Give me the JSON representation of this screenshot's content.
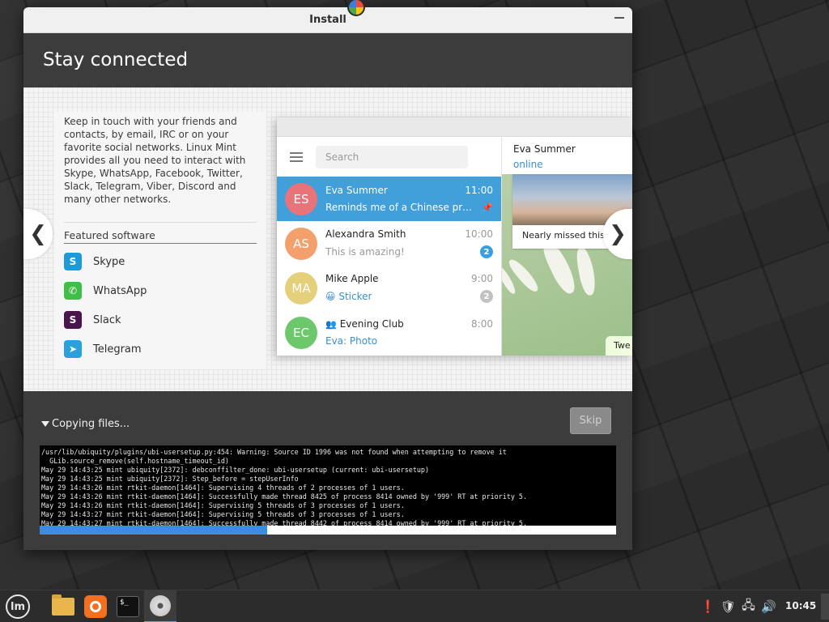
{
  "window": {
    "title": "Install",
    "heading": "Stay connected"
  },
  "slide": {
    "description": "Keep in touch with your friends and contacts, by email, IRC or on your favorite social networks. Linux Mint provides all you need to interact with Skype, WhatsApp, Facebook, Twitter, Slack, Telegram, Viber, Discord and many other networks.",
    "featured_title": "Featured software",
    "software": [
      {
        "label": "Skype",
        "icon": "skype-icon",
        "glyph": "S",
        "color": "#1e9ad7"
      },
      {
        "label": "WhatsApp",
        "icon": "whatsapp-icon",
        "glyph": "✆",
        "color": "#3fbf4a"
      },
      {
        "label": "Slack",
        "icon": "slack-icon",
        "glyph": "S",
        "color": "#4a154b"
      },
      {
        "label": "Telegram",
        "icon": "telegram-icon",
        "glyph": "➤",
        "color": "#2aa1da"
      }
    ],
    "prev_arrow": "❮",
    "next_arrow": "❯"
  },
  "telegram": {
    "search_placeholder": "Search",
    "chats": [
      {
        "initials": "ES",
        "color": "#e8747a",
        "name": "Eva Summer",
        "time": "11:00",
        "preview": "Reminds me of a Chinese prover...",
        "badge": ""
      },
      {
        "initials": "AS",
        "color": "#f3a06c",
        "name": "Alexandra Smith",
        "time": "10:00",
        "preview": "This is amazing!",
        "badge": "2",
        "badge_color": "#3a9fe0"
      },
      {
        "initials": "MA",
        "color": "#e4cf7a",
        "name": "Mike Apple",
        "time": "9:00",
        "preview": "😀 Sticker",
        "badge": "2",
        "badge_color": "#c2c2c2"
      },
      {
        "initials": "EC",
        "color": "#6cc86a",
        "name": "Evening Club",
        "time": "8:00",
        "preview": "Eva: Photo",
        "badge": ""
      }
    ],
    "contact_name": "Eva Summer",
    "contact_status": "online",
    "photo_caption": "Nearly missed this s",
    "bubble_text": "Twe"
  },
  "progress": {
    "label": "Copying files...",
    "skip_label": "Skip",
    "fraction": 0.395,
    "log": "/usr/lib/ubiquity/plugins/ubi-usersetup.py:454: Warning: Source ID 1996 was not found when attempting to remove it\n  GLib.source_remove(self.hostname_timeout_id)\nMay 29 14:43:25 mint ubiquity[2372]: debconffilter_done: ubi-usersetup (current: ubi-usersetup)\nMay 29 14:43:25 mint ubiquity[2372]: Step_before = stepUserInfo\nMay 29 14:43:26 mint rtkit-daemon[1464]: Supervising 4 threads of 2 processes of 1 users.\nMay 29 14:43:26 mint rtkit-daemon[1464]: Successfully made thread 8425 of process 8414 owned by '999' RT at priority 5.\nMay 29 14:43:26 mint rtkit-daemon[1464]: Supervising 5 threads of 3 processes of 1 users.\nMay 29 14:43:27 mint rtkit-daemon[1464]: Supervising 5 threads of 3 processes of 1 users.\nMay 29 14:43:27 mint rtkit-daemon[1464]: Successfully made thread 8442 of process 8414 owned by '999' RT at priority 5."
  },
  "taskbar": {
    "clock": "10:45",
    "terminal_glyph": "$_"
  }
}
